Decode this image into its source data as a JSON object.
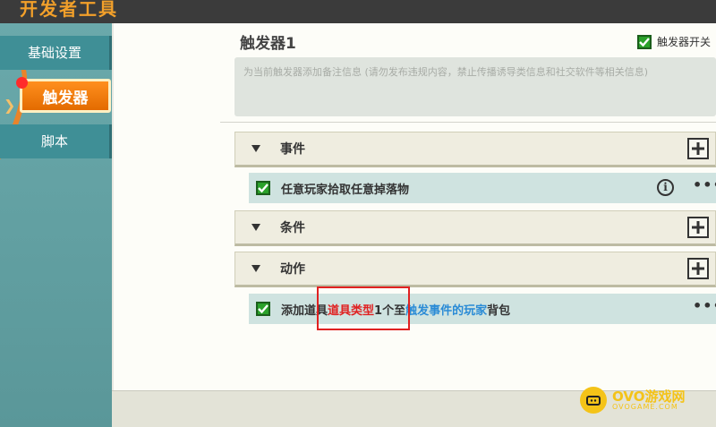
{
  "app": {
    "title": "开发者工具"
  },
  "sidebar": {
    "items": [
      {
        "label": "基础设置"
      },
      {
        "label": "触发器"
      },
      {
        "label": "脚本"
      }
    ]
  },
  "trigger": {
    "title": "触发器1",
    "switch_label": "触发器开关",
    "note_placeholder": "为当前触发器添加备注信息 (请勿发布违规内容，禁止传播诱导类信息和社交软件等相关信息)"
  },
  "sections": {
    "event": {
      "label": "事件",
      "rows": [
        {
          "text": "任意玩家拾取任意掉落物"
        }
      ]
    },
    "condition": {
      "label": "条件"
    },
    "action": {
      "label": "动作",
      "row": {
        "prefix": "添加道具",
        "item_type": "道具类型",
        "count": "1个至",
        "target": "触发事件的玩家",
        "suffix": "背包"
      }
    }
  },
  "watermark": {
    "text": "OVO游戏网",
    "sub": "OVOGAME.COM"
  },
  "colors": {
    "accent": "#e36b00",
    "check": "#2aa12a",
    "highlight": "#e02121",
    "link": "#2a8bd6"
  }
}
